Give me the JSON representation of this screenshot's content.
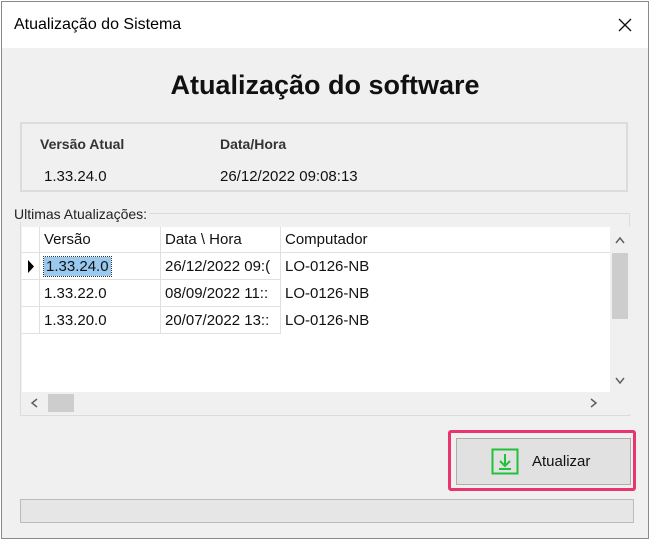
{
  "window": {
    "title": "Atualização do Sistema"
  },
  "heading": "Atualização do software",
  "current": {
    "version_label": "Versão Atual",
    "datetime_label": "Data/Hora",
    "version_value": "1.33.24.0",
    "datetime_value": "26/12/2022 09:08:13"
  },
  "history": {
    "legend": "Ultimas Atualizações:",
    "columns": [
      "Versão",
      "Data \\ Hora",
      "Computador"
    ],
    "rows": [
      {
        "version": "1.33.24.0",
        "datetime": "26/12/2022 09:(",
        "computer": "LO-0126-NB",
        "current": true
      },
      {
        "version": "1.33.22.0",
        "datetime": "08/09/2022 11::",
        "computer": "LO-0126-NB",
        "current": false
      },
      {
        "version": "1.33.20.0",
        "datetime": "20/07/2022 13::",
        "computer": "LO-0126-NB",
        "current": false
      }
    ]
  },
  "update_button": {
    "label": "Atualizar",
    "icon": "download-icon"
  },
  "progress": {
    "value": 0
  },
  "colors": {
    "highlight": "#e8356d",
    "icon_green": "#22c13a",
    "selection": "#99c9ef"
  }
}
